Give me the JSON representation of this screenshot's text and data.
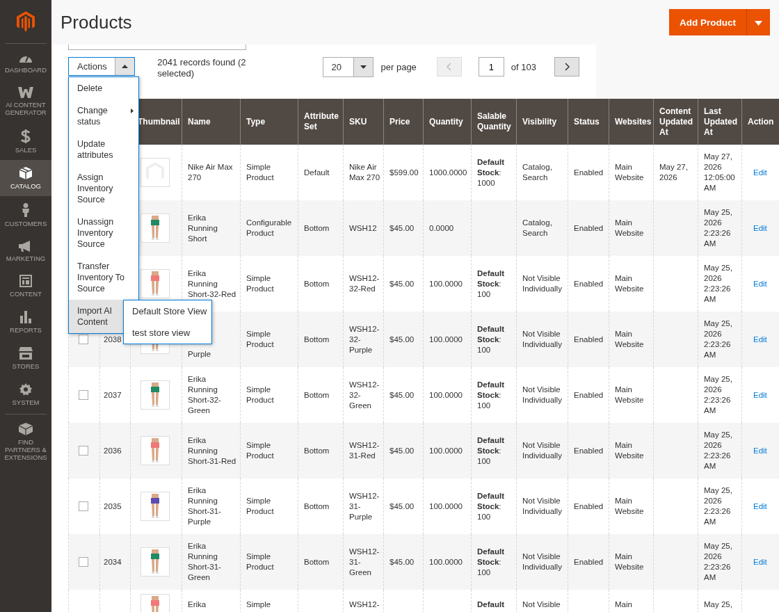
{
  "sidebar": {
    "items": [
      {
        "label": "DASHBOARD",
        "selected": false
      },
      {
        "label": "AI CONTENT GENERATOR",
        "selected": false
      },
      {
        "label": "SALES",
        "selected": false
      },
      {
        "label": "CATALOG",
        "selected": true
      },
      {
        "label": "CUSTOMERS",
        "selected": false
      },
      {
        "label": "MARKETING",
        "selected": false
      },
      {
        "label": "CONTENT",
        "selected": false
      },
      {
        "label": "REPORTS",
        "selected": false
      },
      {
        "label": "STORES",
        "selected": false
      },
      {
        "label": "SYSTEM",
        "selected": false
      },
      {
        "label": "FIND PARTNERS & EXTENSIONS",
        "selected": false
      }
    ]
  },
  "header": {
    "title": "Products",
    "primary_button": "Add Product"
  },
  "toolbar": {
    "actions_label": "Actions",
    "actions_expanded": true,
    "records": "2041 records found (2 selected)",
    "per_page": "20",
    "per_page_label": "per page",
    "page": "1",
    "page_total": "of 103",
    "prev_disabled": true,
    "next_disabled": false
  },
  "actions_menu": [
    {
      "label": "Delete",
      "has_submenu": false,
      "selected": false
    },
    {
      "label": "Change status",
      "has_submenu": true,
      "selected": false
    },
    {
      "label": "Update attributes",
      "has_submenu": false,
      "selected": false
    },
    {
      "label": "Assign Inventory Source",
      "has_submenu": false,
      "selected": false
    },
    {
      "label": "Unassign Inventory Source",
      "has_submenu": false,
      "selected": false
    },
    {
      "label": "Transfer Inventory To Source",
      "has_submenu": false,
      "selected": false
    },
    {
      "label": "Import AI Content",
      "has_submenu": true,
      "selected": true,
      "submenu": [
        "Default Store View",
        "test store view"
      ]
    }
  ],
  "table": {
    "columns": [
      "Thumbnail",
      "Name",
      "Type",
      "Attribute Set",
      "SKU",
      "Price",
      "Quantity",
      "Salable Quantity",
      "Visibility",
      "Status",
      "Websites",
      "Content Updated At",
      "Last Updated At",
      "Action"
    ],
    "rows": [
      {
        "kind": "full",
        "thumbnail": {
          "kind": "placeholder"
        },
        "name": "Nike Air Max 270",
        "type": "Simple Product",
        "attribute_set": "Default",
        "sku": "Nike Air Max 270",
        "price": "$599.00",
        "quantity": "1000.0000",
        "salable_quantity": "**Default Stock**: 1000",
        "visibility": "Catalog, Search",
        "status": "Enabled",
        "websites": "Main Website",
        "content_updated_at": "May 27, 2026",
        "last_updated_at": "May 27, 2026 12:05:00 AM",
        "action": "Edit"
      },
      {
        "kind": "full",
        "thumbnail": {
          "kind": "photo",
          "color": "#1f8a63"
        },
        "name": "Erika Running Short",
        "type": "Configurable Product",
        "attribute_set": "Bottom",
        "sku": "WSH12",
        "price": "$45.00",
        "quantity": "0.0000",
        "visibility": "Catalog, Search",
        "status": "Enabled",
        "websites": "Main Website",
        "last_updated_at": "May 25, 2026 2:23:26 AM",
        "action": "Edit"
      },
      {
        "kind": "full",
        "thumbnail": {
          "kind": "photo",
          "color": "#f07878"
        },
        "name": "Erika Running Short-32-Red",
        "type": "Simple Product",
        "attribute_set": "Bottom",
        "sku": "WSH12-32-Red",
        "price": "$45.00",
        "quantity": "100.0000",
        "salable_quantity": "**Default Stock**: 100",
        "visibility": "Not Visible Individually",
        "status": "Enabled",
        "websites": "Main Website",
        "last_updated_at": "May 25, 2026 2:23:26 AM",
        "action": "Edit"
      },
      {
        "kind": "full",
        "id": "2038",
        "checked": false,
        "thumbnail": {
          "kind": "photo"
        },
        "name": "Purple",
        "name_covered": true,
        "type": "Simple Product",
        "attribute_set": "Bottom",
        "sku": "WSH12-32-Purple",
        "price": "$45.00",
        "quantity": "100.0000",
        "salable_quantity": "**Default Stock**: 100",
        "visibility": "Not Visible Individually",
        "status": "Enabled",
        "websites": "Main Website",
        "last_updated_at": "May 25, 2026 2:23:26 AM",
        "action": "Edit"
      },
      {
        "kind": "full",
        "id": "2037",
        "checked": false,
        "thumbnail": {
          "kind": "photo",
          "color": "#1f8a63"
        },
        "name": "Erika Running Short-32-Green",
        "type": "Simple Product",
        "attribute_set": "Bottom",
        "sku": "WSH12-32-Green",
        "price": "$45.00",
        "quantity": "100.0000",
        "salable_quantity": "**Default Stock**: 100",
        "visibility": "Not Visible Individually",
        "status": "Enabled",
        "websites": "Main Website",
        "last_updated_at": "May 25, 2026 2:23:26 AM",
        "action": "Edit"
      },
      {
        "kind": "full",
        "id": "2036",
        "checked": false,
        "thumbnail": {
          "kind": "photo",
          "color": "#f07878"
        },
        "name": "Erika Running Short-31-Red",
        "type": "Simple Product",
        "attribute_set": "Bottom",
        "sku": "WSH12-31-Red",
        "price": "$45.00",
        "quantity": "100.0000",
        "salable_quantity": "**Default Stock**: 100",
        "visibility": "Not Visible Individually",
        "status": "Enabled",
        "websites": "Main Website",
        "last_updated_at": "May 25, 2026 2:23:26 AM",
        "action": "Edit"
      },
      {
        "kind": "full",
        "id": "2035",
        "checked": false,
        "thumbnail": {
          "kind": "photo",
          "color": "#5a4bb0"
        },
        "name": "Erika Running Short-31-Purple",
        "type": "Simple Product",
        "attribute_set": "Bottom",
        "sku": "WSH12-31-Purple",
        "price": "$45.00",
        "quantity": "100.0000",
        "salable_quantity": "**Default Stock**: 100",
        "visibility": "Not Visible Individually",
        "status": "Enabled",
        "websites": "Main Website",
        "last_updated_at": "May 25, 2026 2:23:26 AM",
        "action": "Edit"
      },
      {
        "kind": "full",
        "id": "2034",
        "checked": false,
        "thumbnail": {
          "kind": "photo",
          "color": "#1f8a63"
        },
        "name": "Erika Running Short-31-Green",
        "type": "Simple Product",
        "attribute_set": "Bottom",
        "sku": "WSH12-31-Green",
        "price": "$45.00",
        "quantity": "100.0000",
        "salable_quantity": "**Default Stock**: 100",
        "visibility": "Not Visible Individually",
        "status": "Enabled",
        "websites": "Main Website",
        "last_updated_at": "May 25, 2026 2:23:26 AM",
        "action": "Edit"
      },
      {
        "kind": "cut",
        "thumbnail": {
          "kind": "photo",
          "color": "#f07878"
        },
        "name": "Erika",
        "type": "Simple",
        "sku": "WSH12-",
        "salable_quantity": "**Default**",
        "visibility": "Not Visible",
        "websites": "Main",
        "last_updated_at": "May 25,"
      }
    ]
  }
}
